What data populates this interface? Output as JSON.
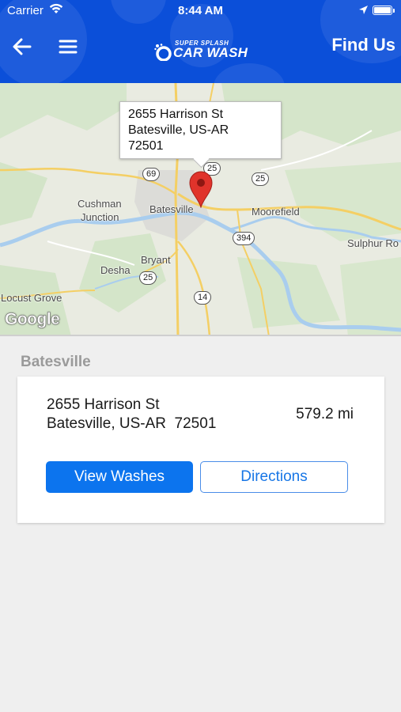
{
  "status_bar": {
    "carrier": "Carrier",
    "time": "8:44 AM",
    "icons": [
      "wifi-icon",
      "location-arrow-icon",
      "battery-icon"
    ]
  },
  "header": {
    "back_icon": "arrow-left-icon",
    "menu_icon": "hamburger-menu-icon",
    "logo_top": "SUPER SPLASH",
    "logo_bottom": "CAR WASH",
    "title": "Find Us",
    "background_color": "#0b4fd9"
  },
  "map": {
    "callout": {
      "line1": "2655 Harrison St",
      "line2": "Batesville, US-AR",
      "line3": "72501"
    },
    "places": [
      "Cushman",
      "Junction",
      "Batesville",
      "Moorefield",
      "Sulphur Ro",
      "Bryant",
      "Desha",
      "Locust Grove"
    ],
    "route_shields": [
      "69",
      "25",
      "25",
      "394",
      "25",
      "14"
    ],
    "attribution": "Google"
  },
  "location": {
    "section_title": "Batesville",
    "address_line1": "2655 Harrison St",
    "address_line2": "Batesville, US-AR  72501",
    "distance": "579.2 mi",
    "view_washes_label": "View Washes",
    "directions_label": "Directions"
  }
}
